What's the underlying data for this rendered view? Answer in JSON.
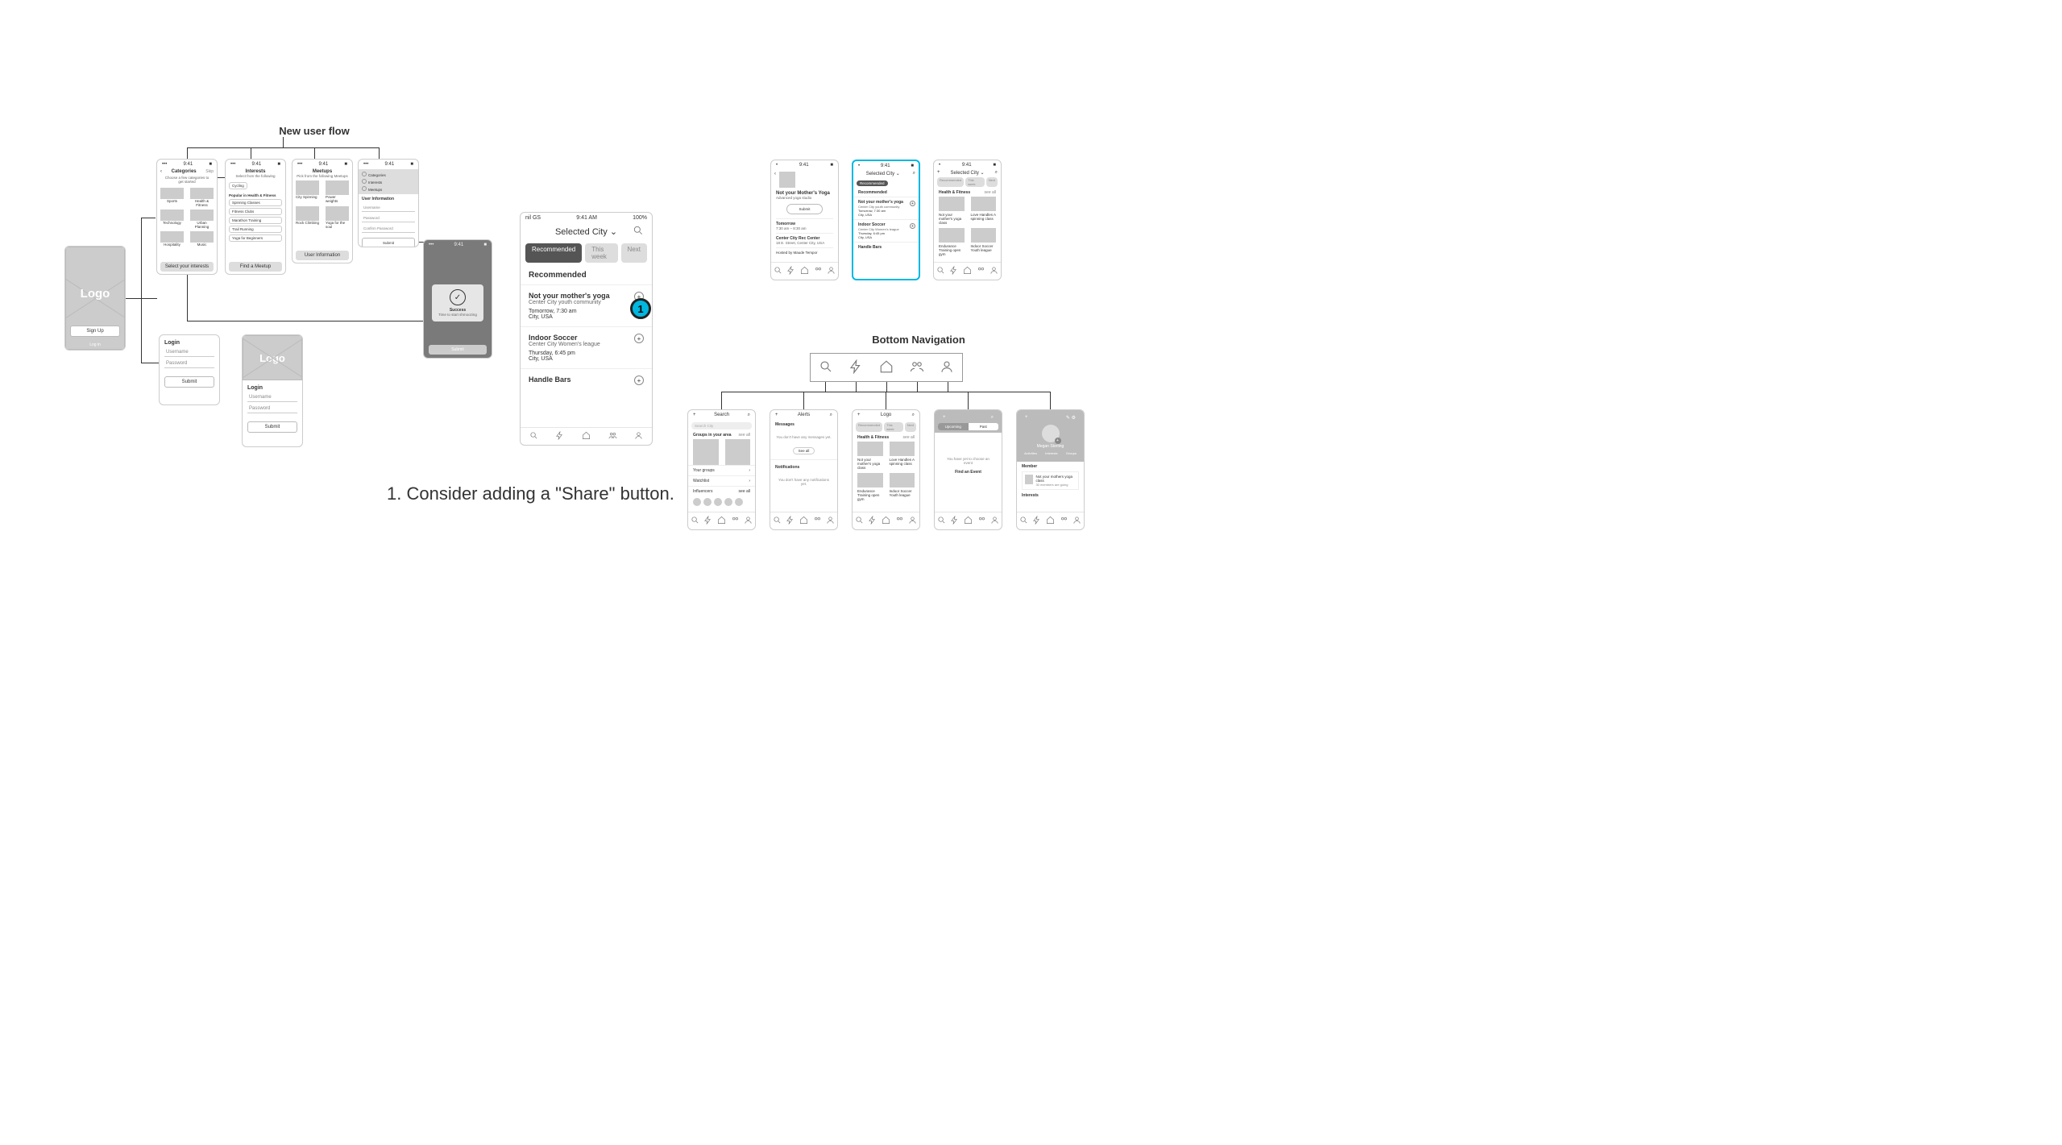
{
  "sections": {
    "new_user_flow_title": "New user flow",
    "bottom_nav_title": "Bottom Navigation"
  },
  "splash": {
    "logo_text": "Logo",
    "signup_label": "Sign Up",
    "login_label": "Log in"
  },
  "login": {
    "title": "Login",
    "username_label": "Username",
    "password_label": "Password",
    "submit_label": "Submit"
  },
  "categories": {
    "title": "Categories",
    "skip_label": "Skip",
    "lead": "Choose a few categories to get started",
    "items": [
      "Sports",
      "Health & Fitness",
      "Technology",
      "Urban Planning",
      "Hospitality",
      "Music"
    ],
    "cta": "Select your interests"
  },
  "interests": {
    "title": "Interests",
    "subtitle": "Select from the following",
    "sport_options": [
      "Cycling"
    ],
    "popular_header": "Popular in Health & Fitness",
    "pills": [
      "Spinning Classes",
      "Fitness Clubs",
      "Marathon Training",
      "Trail Running",
      "Yoga for Beginners"
    ],
    "cta": "Find a Meetup"
  },
  "meetups": {
    "title": "Meetups",
    "subtitle": "Pick from the following Meetups",
    "row1": [
      "City Spinning",
      "Power weights"
    ],
    "row2": [
      "Rock Climbing",
      "Yoga for the soul"
    ],
    "cta": "User Information"
  },
  "userinfo": {
    "nav_items": [
      "Categories",
      "Interests",
      "Meetups"
    ],
    "header": "User Information",
    "fields": [
      "Username",
      "Password",
      "Confirm Password"
    ],
    "submit_label": "Submit"
  },
  "success_modal": {
    "title": "Success",
    "subtitle": "Time to start shmoozing",
    "submit_label": "Submit"
  },
  "feed_large": {
    "status": {
      "carrier": "nil GS",
      "time": "9:41 AM",
      "battery": "100%"
    },
    "selected_city": "Selected City",
    "tabs": [
      "Recommended",
      "This week",
      "Next"
    ],
    "section_header": "Recommended",
    "events": [
      {
        "title": "Not your mother's yoga",
        "org": "Center City youth community",
        "when": "Tomorrow, 7:30 am",
        "where": "City, USA"
      },
      {
        "title": "Indoor Soccer",
        "org": "Center City Women's league",
        "when": "Thursday, 6:45 pm",
        "where": "City, USA"
      },
      {
        "title": "Handle Bars",
        "org": "",
        "when": "",
        "where": ""
      }
    ]
  },
  "detail_small": {
    "title": "Not your Mother's Yoga",
    "sub": "Advanced yoga studio",
    "submit": "Submit",
    "when_label": "Tomorrow",
    "when_time": "7:30 am – 8:30 am",
    "venue_name": "Center City Rec Center",
    "venue_addr": "18 E. Street, Center City, USA",
    "host": "Hosted by Maude Tempor"
  },
  "feed_small_highlight": {
    "selected_city": "Selected City",
    "tab": "Recommended",
    "section": "Recommended",
    "events": [
      {
        "title": "Not your mother's yoga",
        "org": "Center City youth community",
        "when": "Tomorrow, 7:30 am",
        "where": "City, USA"
      },
      {
        "title": "Indoor Soccer",
        "org": "Center City Women's league",
        "when": "Thursday, 6:45 pm",
        "where": "City, USA"
      },
      {
        "title": "Handle Bars",
        "org": "",
        "when": "",
        "where": ""
      }
    ]
  },
  "browse_small": {
    "selected_city": "Selected City",
    "tabs": [
      "Recommended",
      "This week",
      "Next"
    ],
    "section": "Health & Fitness",
    "see_all": "see all",
    "cards_row1": [
      "Not your mother's yoga class",
      "Love Handles A spinning class"
    ],
    "cards_row2": [
      "Endurance Training open gym",
      "Indoor Soccer Youth league"
    ]
  },
  "nav_screens": {
    "search": {
      "title": "Search",
      "placeholder": "Search City",
      "groups_header": "Groups in your area",
      "see_all": "see all",
      "rows": [
        "Your groups",
        "Watchlist",
        "Influencers"
      ]
    },
    "alerts": {
      "title": "Alerts",
      "messages_header": "Messages",
      "no_msg": "You don't have any messages yet.",
      "see_all": "See all",
      "notif_header": "Notifications",
      "no_notif": "You don't have any notifications yet."
    },
    "home": {
      "title": "Logo",
      "tabs": [
        "Recommended",
        "This week",
        "Next"
      ],
      "section": "Health & Fitness",
      "see_all": "see all",
      "cards_row1": [
        "Not your mother's yoga class",
        "Love Handles A spinning class"
      ],
      "cards_row2": [
        "Endurance Training open gym",
        "Indoor Soccer Youth league"
      ]
    },
    "events": {
      "tabs": [
        "Upcoming",
        "Past"
      ],
      "empty_line": "You have yet to choose an event",
      "cta": "Find an Event"
    },
    "profile": {
      "name": "Megan Sterling",
      "stats": [
        "Activities",
        "Interests",
        "Groups"
      ],
      "member_header": "Member",
      "member_item": "Not your mothers yoga class",
      "member_sub": "30 members are going",
      "interests_header": "Interests"
    }
  },
  "annotation": {
    "badge_number": "1",
    "text": "1. Consider adding a \"Share\" button."
  }
}
